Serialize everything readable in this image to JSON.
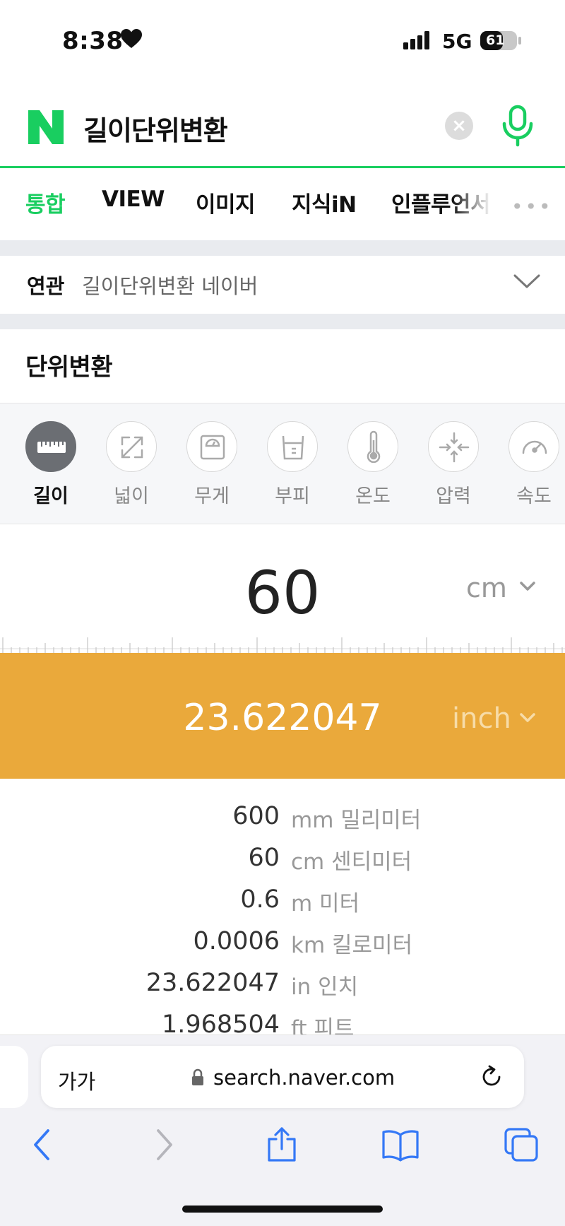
{
  "status_bar": {
    "time": "8:38",
    "network": "5G",
    "battery": "61",
    "battery_level_pct": 61
  },
  "search": {
    "query": "길이단위변환",
    "clear_icon": "close-icon",
    "mic_icon": "microphone-icon"
  },
  "tabs": [
    {
      "label": "통합",
      "active": true
    },
    {
      "label": "VIEW"
    },
    {
      "label": "이미지"
    },
    {
      "label": "지식iN"
    },
    {
      "label": "인플루언서"
    }
  ],
  "tabs_more": "•••",
  "related": {
    "label": "연관",
    "text": "길이단위변환 네이버"
  },
  "converter": {
    "title": "단위변환",
    "categories": [
      {
        "label": "길이",
        "icon": "ruler-icon",
        "active": true
      },
      {
        "label": "넓이",
        "icon": "expand-icon"
      },
      {
        "label": "무게",
        "icon": "scale-icon"
      },
      {
        "label": "부피",
        "icon": "beaker-icon"
      },
      {
        "label": "온도",
        "icon": "thermometer-icon"
      },
      {
        "label": "압력",
        "icon": "compress-icon"
      },
      {
        "label": "속도",
        "icon": "speedometer-icon"
      }
    ],
    "input_value": "60",
    "input_unit": "cm",
    "result_value": "23.622047",
    "result_unit": "inch",
    "accent_color": "#eaa93b",
    "results": [
      {
        "value": "600",
        "unit": "mm 밀리미터"
      },
      {
        "value": "60",
        "unit": "cm 센티미터"
      },
      {
        "value": "0.6",
        "unit": "m 미터"
      },
      {
        "value": "0.0006",
        "unit": "km 킬로미터"
      },
      {
        "value": "23.622047",
        "unit": "in 인치"
      },
      {
        "value": "1.968504",
        "unit": "ft 피트"
      }
    ]
  },
  "browser": {
    "text_size_label": "가가",
    "url": "search.naver.com"
  }
}
